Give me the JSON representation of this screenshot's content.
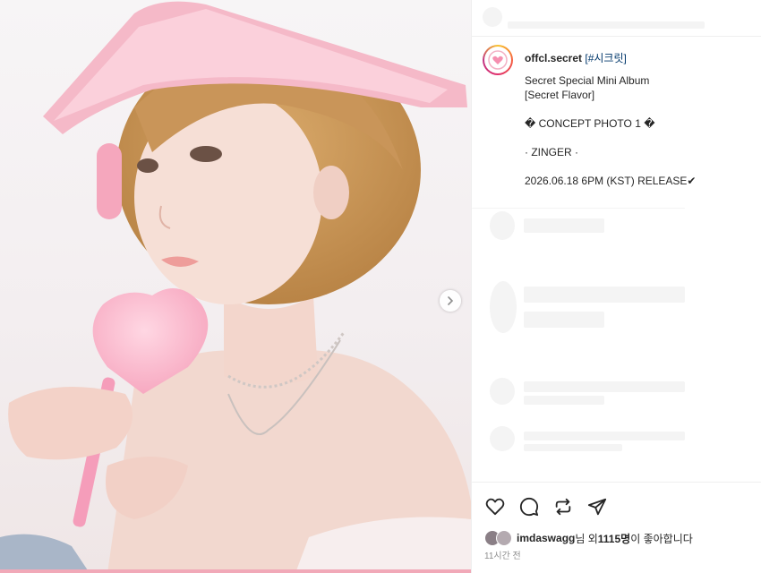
{
  "post": {
    "username": "offcl.secret",
    "hashtag": "[#시크릿]",
    "caption_lines": [
      "Secret Special Mini Album",
      "[Secret Flavor]",
      "",
      "� CONCEPT PHOTO 1 �",
      "",
      "· ZINGER ·",
      "",
      "2026.06.18 6PM (KST) RELEASE✔"
    ]
  },
  "likes": {
    "liker": "imdaswagg",
    "suffix_1": "님 외 ",
    "count": "1115명",
    "suffix_2": "이 좋아합니다"
  },
  "time_ago": "11시간 전",
  "icons": {
    "like": "heart-icon",
    "comment": "comment-icon",
    "share": "repost-icon",
    "send": "send-icon",
    "next": "chevron-right-icon"
  },
  "colors": {
    "text": "#262626",
    "muted": "#8e8e8e",
    "link": "#00376b",
    "skeleton": "#f4f4f4"
  }
}
